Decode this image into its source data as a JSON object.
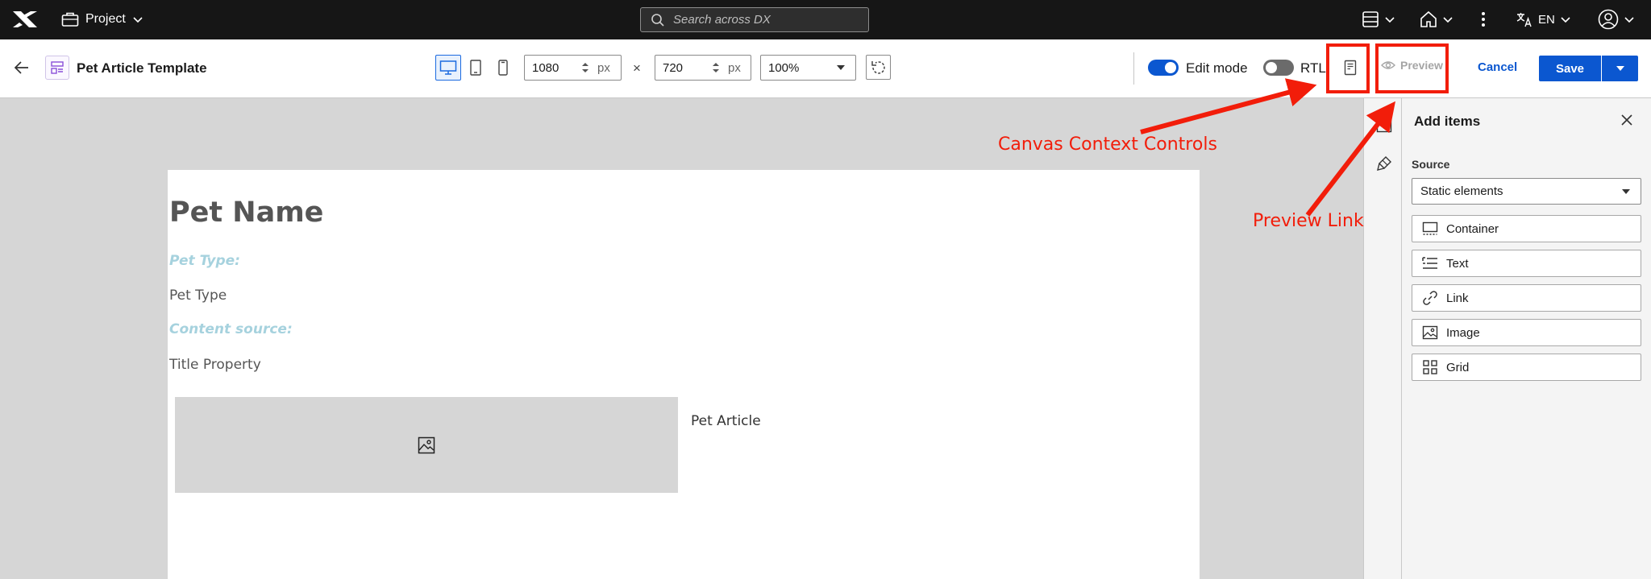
{
  "topbar": {
    "project_label": "Project",
    "search_placeholder": "Search across DX",
    "language": "EN"
  },
  "toolbar": {
    "title": "Pet Article Template",
    "width_value": "1080",
    "height_value": "720",
    "unit": "px",
    "times": "×",
    "zoom": "100%",
    "edit_mode_label": "Edit mode",
    "edit_mode_on": true,
    "rtl_label": "RTL",
    "rtl_on": false,
    "preview_label": "Preview",
    "cancel_label": "Cancel",
    "save_label": "Save"
  },
  "canvas": {
    "title": "Pet Name",
    "label1": "Pet Type:",
    "text1": "Pet Type",
    "label2": "Content source:",
    "text2": "Title Property",
    "article_text": "Pet Article"
  },
  "panel": {
    "title": "Add items",
    "source_label": "Source",
    "source_value": "Static elements",
    "items": [
      {
        "label": "Container",
        "icon": "container-icon"
      },
      {
        "label": "Text",
        "icon": "text-icon"
      },
      {
        "label": "Link",
        "icon": "link-icon"
      },
      {
        "label": "Image",
        "icon": "image-icon"
      },
      {
        "label": "Grid",
        "icon": "grid-icon"
      }
    ]
  },
  "annotations": {
    "canvas_context": "Canvas Context Controls",
    "preview_link": "Preview Link"
  },
  "colors": {
    "topbar_bg": "#161616",
    "accent": "#0b57d0",
    "annotation": "#f21d0a",
    "canvas_label": "#a6d2de"
  }
}
